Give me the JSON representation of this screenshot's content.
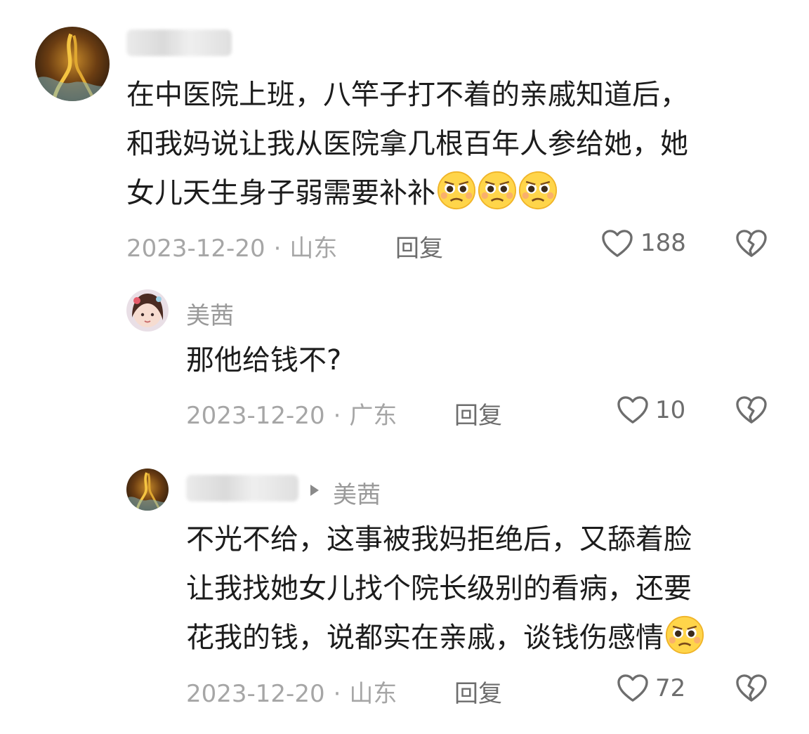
{
  "comments": [
    {
      "text_lines": [
        "在中医院上班，八竿子打不着的亲戚知道后，",
        "和我妈说让我从医院拿几根百年人参给她，她",
        "女儿天生身子弱需要补补"
      ],
      "emojis": [
        "pleading-face",
        "pleading-face",
        "pleading-face"
      ],
      "date": "2023-12-20",
      "location": "山东",
      "reply_label": "回复",
      "likes": "188"
    },
    {
      "username": "美茜",
      "text_lines": [
        "那他给钱不?"
      ],
      "date": "2023-12-20",
      "location": "广东",
      "reply_label": "回复",
      "likes": "10"
    },
    {
      "reply_to": "美茜",
      "text_lines": [
        "不光不给，这事被我妈拒绝后，又舔着脸",
        "让我找她女儿找个院长级别的看病，还要",
        "花我的钱，说都实在亲戚，谈钱伤感情"
      ],
      "emojis": [
        "pleading-face"
      ],
      "date": "2023-12-20",
      "location": "山东",
      "reply_label": "回复",
      "likes": "72"
    }
  ],
  "separator": "·"
}
